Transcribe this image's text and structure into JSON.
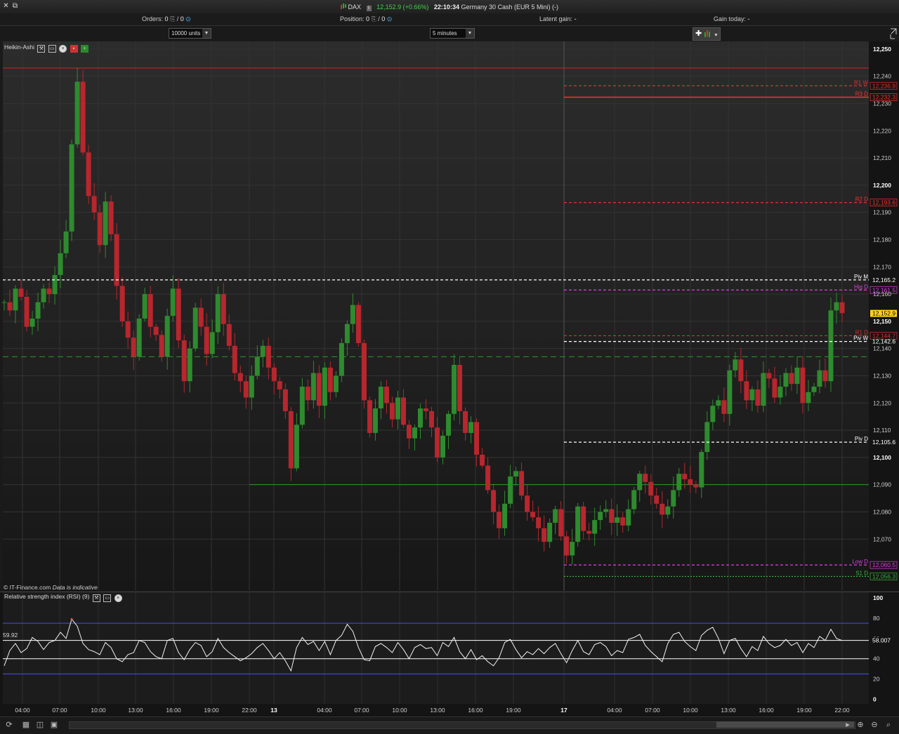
{
  "window": {
    "instrument": "DAX",
    "price": "12,152.9",
    "change": "(+0.66%)",
    "time": "22:10:34",
    "description": "Germany 30 Cash (EUR 5 Mini) (-)",
    "close_icon": "close-icon",
    "popout_icon": "popout-icon"
  },
  "infobar": {
    "orders_label": "Orders:",
    "orders_value": "0",
    "orders_value2": "0",
    "position_label": "Position:",
    "position_value": "0",
    "position_value2": "0",
    "latent_label": "Latent gain:",
    "latent_value": "-",
    "gain_label": "Gain today:",
    "gain_value": "-"
  },
  "toolbar": {
    "units": "10000 units",
    "timeframe": "5 minutes"
  },
  "main_panel": {
    "label": "Heikin-Ashi",
    "copyright": "© IT-Finance.com",
    "disclaimer": "Data is indicative"
  },
  "rsi_panel": {
    "label": "Relative strength index (RSI) (9)",
    "left_value": "59.92"
  },
  "colors": {
    "background": "#1d1d1d",
    "up_candle": "#2e8b2e",
    "down_candle": "#b8262e",
    "resistance": "#ff3a3a",
    "support": "#3cb83c",
    "pivot": "#ffffff",
    "high_low": "#e040e0",
    "price_tag": "#ffd21e",
    "rsi_band": "#4a4aff"
  },
  "chart_data": [
    {
      "type": "line",
      "title": "Heikin-Ashi",
      "y_ticks": [
        "12,250",
        "12,240",
        "12,230",
        "12,220",
        "12,210",
        "12,200",
        "12,190",
        "12,180",
        "12,170",
        "12,160",
        "12,150",
        "12,140",
        "12,130",
        "12,120",
        "12,110",
        "12,100",
        "12,090",
        "12,080",
        "12,070"
      ],
      "ylim": [
        12060,
        12251
      ],
      "x_ticks": [
        "04:00",
        "07:00",
        "10:00",
        "13:00",
        "16:00",
        "19:00",
        "22:00",
        "13",
        "04:00",
        "07:00",
        "10:00",
        "13:00",
        "16:00",
        "19:00",
        "17",
        "04:00",
        "07:00",
        "10:00",
        "13:00",
        "16:00",
        "19:00",
        "22:00"
      ],
      "levels": [
        {
          "label": "R1 W",
          "value": 12236.5,
          "price_label": "12,236.9",
          "style": "dashed",
          "color": "#e03030"
        },
        {
          "label": "R3 D",
          "value": 12232.3,
          "price_label": "12,232.3",
          "style": "solid",
          "color": "#ff3030"
        },
        {
          "label": "R2 D",
          "value": 12193.6,
          "price_label": "12,193.6",
          "style": "dashed",
          "color": "#ff3030"
        },
        {
          "label": "Piv M",
          "value": 12165.2,
          "price_label": "12,165.2",
          "style": "dashed",
          "color": "#ffffff"
        },
        {
          "label": "Hig D",
          "value": 12161.5,
          "price_label": "12,161.5",
          "style": "dashed",
          "color": "#e040e0"
        },
        {
          "label": "",
          "value": 12153.3,
          "price_label": "12,153.3",
          "style": "none",
          "color": "#ffffff"
        },
        {
          "label": "",
          "value": 12152.9,
          "price_label": "12,152.9",
          "style": "tag",
          "color": "#ffd21e"
        },
        {
          "label": "R1 D",
          "value": 12144.7,
          "price_label": "12,144.7",
          "style": "dashed",
          "color": "#e03030"
        },
        {
          "label": "Piv W",
          "value": 12142.6,
          "price_label": "12,142.6",
          "style": "dashed",
          "color": "#ffffff"
        },
        {
          "label": "Piv D",
          "value": 12105.6,
          "price_label": "12,105.6",
          "style": "dashed",
          "color": "#ffffff"
        },
        {
          "label": "Low D",
          "value": 12060.5,
          "price_label": "12,060.5",
          "style": "dashed",
          "color": "#e040e0"
        },
        {
          "label": "S1 D",
          "value": 12056.3,
          "price_label": "12,056.3",
          "style": "dotted",
          "color": "#3cb83c"
        }
      ],
      "series": [
        {
          "values": [
            12157,
            12154,
            12162,
            12159,
            12148,
            12151,
            12157,
            12162,
            12160,
            12167,
            12175,
            12183,
            12215,
            12238,
            12212,
            12196,
            12190,
            12178,
            12194,
            12182,
            12163,
            12150,
            12144,
            12137,
            12151,
            12160,
            12148,
            12145,
            12137,
            12152,
            12162,
            12143,
            12128,
            12140,
            12155,
            12148,
            12138,
            12146,
            12160,
            12149,
            12141,
            12131,
            12128,
            12122,
            12130,
            12137,
            12141,
            12133,
            12128,
            12125,
            12117,
            12096,
            12112,
            12126,
            12121,
            12131,
            12119,
            12133,
            12124,
            12130,
            12142,
            12149,
            12156,
            12142,
            12121,
            12109,
            12118,
            12126,
            12120,
            12114,
            12122,
            12112,
            12107,
            12111,
            12118,
            12117,
            12111,
            12100,
            12108,
            12116,
            12134,
            12117,
            12109,
            12113,
            12101,
            12097,
            12088,
            12080,
            12074,
            12083,
            12093,
            12095,
            12086,
            12080,
            12078,
            12074,
            12069,
            12076,
            12081,
            12071,
            12064,
            12069,
            12082,
            12073,
            12072,
            12077,
            12080,
            12081,
            12076,
            12078,
            12075,
            12081,
            12088,
            12094,
            12091,
            12086,
            12083,
            12079,
            12082,
            12088,
            12094,
            12092,
            12090,
            12089,
            12102,
            12113,
            12119,
            12121,
            12116,
            12132,
            12136,
            12128,
            12121,
            12125,
            12119,
            12131,
            12129,
            12122,
            12126,
            12131,
            12127,
            12133,
            12120,
            12124,
            12126,
            12132,
            12128,
            12154,
            12157,
            12153
          ]
        }
      ]
    },
    {
      "type": "line",
      "title": "Relative strength index (RSI) (9)",
      "y_ticks": [
        "100",
        "80",
        "60",
        "40",
        "20",
        "0"
      ],
      "ylim": [
        0,
        100
      ],
      "levels": [
        {
          "label": "",
          "value": 75,
          "color": "#4a4aff"
        },
        {
          "label": "58.007",
          "value": 58.007,
          "color": "#ffffff"
        },
        {
          "label": "",
          "value": 40,
          "color": "#ffffff"
        },
        {
          "label": "",
          "value": 25,
          "color": "#4a4aff"
        }
      ],
      "series": [
        {
          "values": [
            33,
            48,
            55,
            46,
            50,
            61,
            57,
            49,
            56,
            58,
            66,
            60,
            79,
            72,
            55,
            49,
            47,
            44,
            56,
            51,
            40,
            37,
            44,
            46,
            58,
            56,
            47,
            42,
            40,
            58,
            60,
            46,
            39,
            49,
            56,
            53,
            42,
            47,
            60,
            51,
            46,
            42,
            38,
            41,
            45,
            51,
            55,
            48,
            40,
            46,
            38,
            28,
            51,
            61,
            54,
            57,
            48,
            57,
            44,
            58,
            63,
            74,
            67,
            51,
            39,
            38,
            52,
            55,
            51,
            46,
            56,
            49,
            40,
            51,
            54,
            50,
            51,
            43,
            56,
            52,
            61,
            47,
            40,
            49,
            39,
            43,
            37,
            33,
            41,
            56,
            59,
            49,
            41,
            47,
            44,
            50,
            45,
            51,
            55,
            45,
            36,
            48,
            58,
            47,
            44,
            54,
            56,
            52,
            43,
            48,
            46,
            59,
            61,
            64,
            53,
            47,
            42,
            37,
            55,
            64,
            66,
            57,
            52,
            48,
            63,
            68,
            71,
            60,
            45,
            58,
            60,
            50,
            42,
            52,
            48,
            62,
            55,
            51,
            53,
            59,
            53,
            56,
            46,
            55,
            51,
            62,
            58,
            69,
            60,
            58
          ]
        }
      ]
    }
  ]
}
